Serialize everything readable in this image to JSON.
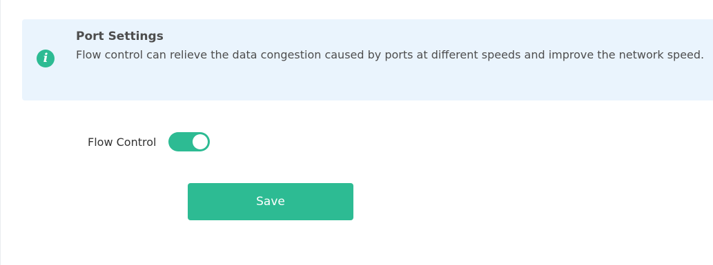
{
  "info": {
    "title": "Port Settings",
    "description": "Flow control can relieve the data congestion caused by ports at different speeds and improve the network speed.",
    "icon": "info-icon",
    "icon_glyph": "i"
  },
  "form": {
    "flow_control": {
      "label": "Flow Control",
      "enabled": true
    },
    "save_label": "Save"
  },
  "colors": {
    "accent": "#2dbb93",
    "info_background": "#eaf4fd",
    "text": "#4d4d4d"
  }
}
